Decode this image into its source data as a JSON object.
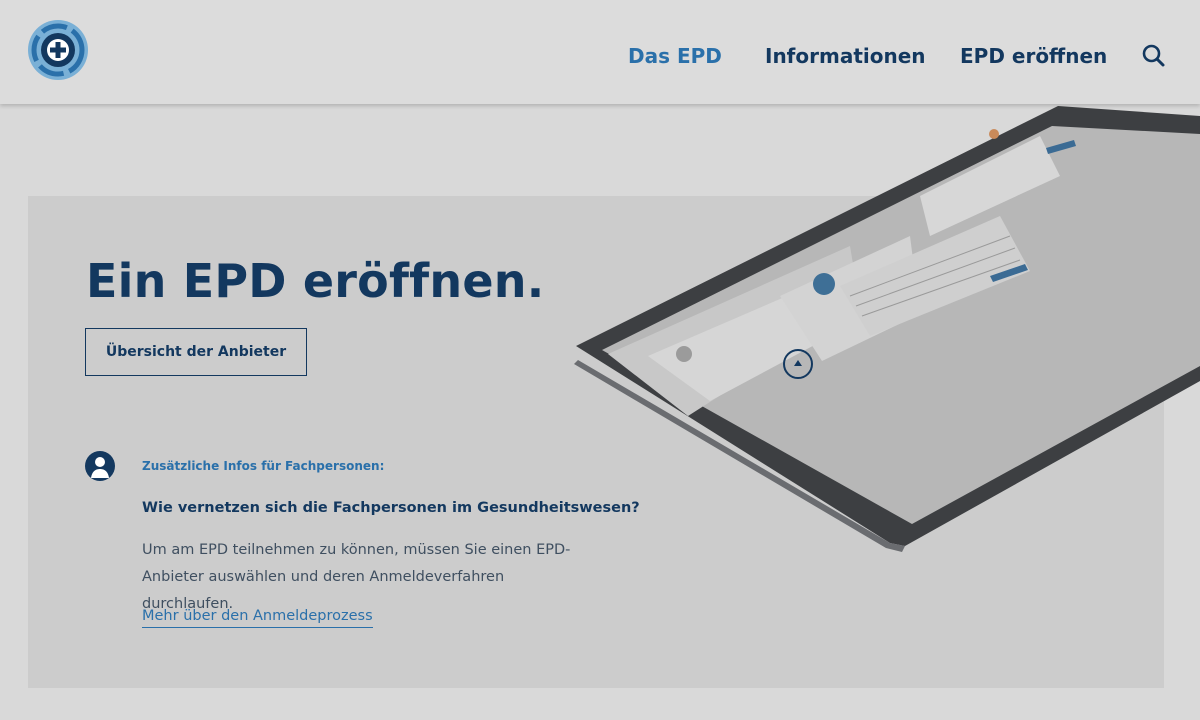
{
  "header": {
    "nav": [
      {
        "label": "Das EPD",
        "active": true
      },
      {
        "label": "Informationen",
        "active": false
      },
      {
        "label": "EPD eröffnen",
        "active": false
      }
    ],
    "search_icon": "search-icon"
  },
  "hero": {
    "title": "Ein EPD eröffnen.",
    "button_label": "Übersicht der Anbieter",
    "image": "tablet-screenshot"
  },
  "info": {
    "icon": "person-icon",
    "label": "Zusätzliche Infos für Fachpersonen:",
    "question": "Wie vernetzen sich die Fachpersonen im Gesundheitswesen?",
    "body": "Um am EPD teilnehmen zu können, müssen Sie einen EPD-Anbieter auswählen und deren Anmeldeverfahren durchlaufen.",
    "link": "Mehr über den Anmeldeprozess"
  },
  "colors": {
    "primary": "#13385f",
    "accent": "#2a70aa",
    "page_bg": "#d9d9d9",
    "hero_bg": "#cccccc"
  }
}
